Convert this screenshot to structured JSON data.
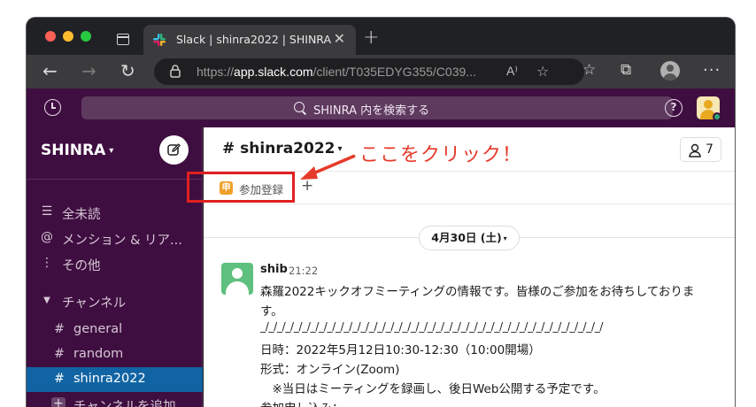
{
  "browser": {
    "tab_title": "Slack | shinra2022 | SHINRA",
    "close_label": "✕",
    "new_tab_label": "+",
    "url_prefix": "https://",
    "url_host": "app.slack.com",
    "url_path": "/client/T035EDYG355/C039...",
    "read_aloud_label": "A⁾",
    "more_label": "···"
  },
  "slack_top": {
    "search_placeholder": "SHINRA 内を検索する",
    "help_label": "?"
  },
  "sidebar": {
    "workspace_name": "SHINRA",
    "items": [
      {
        "icon": "☰",
        "label": "全未読"
      },
      {
        "icon": "@",
        "label": "メンション & リア..."
      },
      {
        "icon": "⋮",
        "label": "その他"
      }
    ],
    "channels_header": {
      "icon": "▼",
      "label": "チャンネル"
    },
    "channels": [
      {
        "icon": "#",
        "label": "general",
        "active": false
      },
      {
        "icon": "#",
        "label": "random",
        "active": false
      },
      {
        "icon": "#",
        "label": "shinra2022",
        "active": true
      }
    ],
    "add_channel": {
      "icon": "+",
      "label": "チャンネルを追加..."
    }
  },
  "channel": {
    "title": "# shinra2022",
    "member_count": "7",
    "bookmark_icon": "申",
    "bookmark_label": "参加登録",
    "bookmark_add": "+",
    "annotation": "ここをクリック！",
    "date": "4月30日 (土)",
    "message": {
      "author": "shib",
      "time": "21:22",
      "lines": [
        "森羅2022キックオフミーティングの情報です。皆様のご参加をお待ちしておりま",
        "す。",
        "_/_/_/_/_/_/_/_/_/_/_/_/_/_/_/_/_/_/_/_/_/_/_/_/_/_/_/_/_/_/_/_/_/_/_/_/_/_/_/_/_/",
        "日時：2022年5月12日10:30-12:30（10:00開場）",
        "形式：オンライン(Zoom)",
        "　※当日はミーティングを録画し、後日Web公開する予定です。",
        "参加申し込み："
      ]
    }
  },
  "colors": {
    "slack_aubergine": "#3f0e40",
    "active_channel": "#1164a3",
    "annotation_red": "#e53a2a"
  }
}
